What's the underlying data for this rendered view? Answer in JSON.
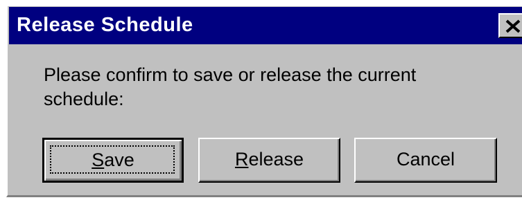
{
  "dialog": {
    "title": "Release Schedule",
    "message": "Please confirm to save or release the current schedule:",
    "close_icon": "close-icon"
  },
  "buttons": {
    "save": {
      "mnemonic": "S",
      "rest": "ave"
    },
    "release": {
      "mnemonic": "R",
      "rest": "elease"
    },
    "cancel": {
      "label": "Cancel"
    }
  },
  "colors": {
    "title_bar": "#000080",
    "dialog_face": "#c0c0c0"
  }
}
